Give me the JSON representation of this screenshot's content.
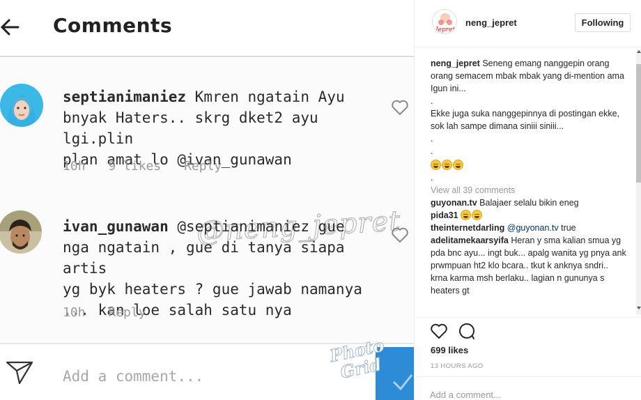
{
  "screenshot": {
    "title": "Comments",
    "comments": [
      {
        "username": "septianimaniez",
        "text_lines": [
          "Kmren ngatain Ayu",
          "bnyak Haters.. skrg dket2 ayu lgi.plin",
          "plan amat lo @ivan_gunawan"
        ],
        "time": "10h",
        "likes": "9 likes",
        "reply": "Reply"
      },
      {
        "username": "ivan_gunawan",
        "text_lines": [
          "@septianimaniez gue",
          "nga ngatain , gue di tanya  siapa artis",
          "yg byk heaters ?  gue jawab namanya",
          "... kan loe salah satu nya"
        ],
        "time": "10h",
        "reply": "Reply"
      }
    ],
    "watermark": "@neng_jepret",
    "add_comment_placeholder": "Add a comment...",
    "photogrid_watermark": [
      "Photo",
      "Grid"
    ]
  },
  "post": {
    "username": "neng_jepret",
    "follow_label": "Following",
    "caption_user": "neng_jepret",
    "caption_lines": [
      "Seneng emang nanggepin orang orang semacem mbak mbak yang di-mention ama Igun ini...",
      ".",
      "Ekke juga suka nanggepinnya di postingan ekke, sok lah sampe dimana siniii siniii...",
      ".",
      "."
    ],
    "caption_dot_after": ".",
    "view_all": "View all 39 comments",
    "comments": [
      {
        "user": "guyonan.tv",
        "text": "Balajaer selalu bikin eneg"
      },
      {
        "user": "pida31",
        "text": ""
      },
      {
        "user": "theinternetdarling",
        "tag": "@guyonan.tv",
        "text": "true"
      },
      {
        "user": "adelitamekaarsyifa",
        "text": "Heran y sma kalian smua yg pda bnc ayu... ingt buk... apalg wanita yg pnya ank prwmpuan ht2 klo bcara.. tkut k anknya sndri.. krna karma msh berlaku.. lagian n gununya s heaters gt"
      }
    ],
    "likes": "699 likes",
    "time_ago": "13 HOURS AGO",
    "add_comment_placeholder": "Add a comment...",
    "icons": [
      "back-arrow-icon",
      "heart-icon",
      "send-icon",
      "comment-bubble-icon",
      "grimace-emoji-icon"
    ],
    "colors": {
      "accent_blue": "#2e8bd6",
      "link": "#003569",
      "muted": "#999999"
    }
  }
}
